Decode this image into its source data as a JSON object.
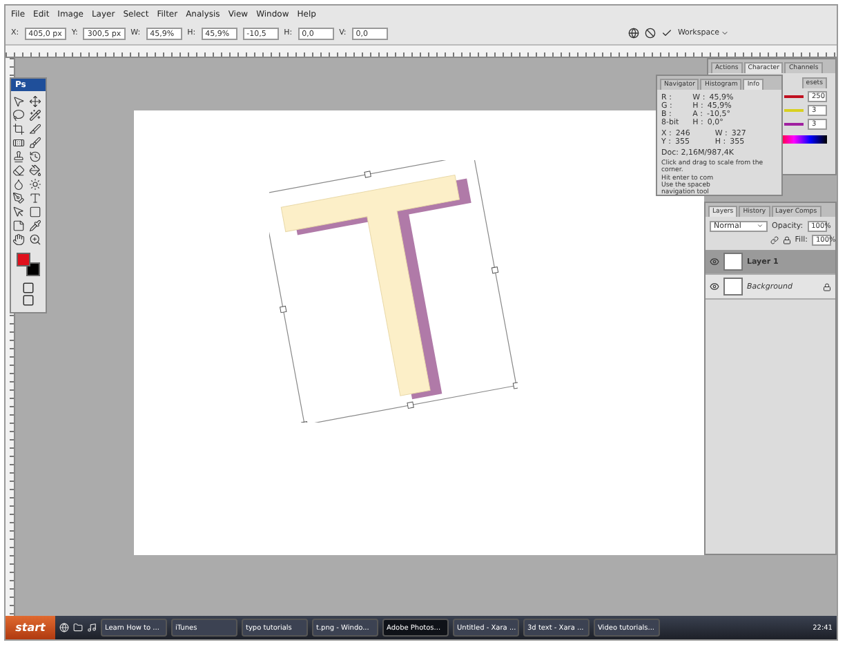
{
  "menu": [
    "File",
    "Edit",
    "Image",
    "Layer",
    "Select",
    "Filter",
    "Analysis",
    "View",
    "Window",
    "Help"
  ],
  "options": {
    "fields": [
      {
        "label": "X:",
        "value": "405,0 px"
      },
      {
        "label": "Y:",
        "value": "300,5 px"
      },
      {
        "label": "W:",
        "value": "45,9%"
      },
      {
        "label": "H:",
        "value": "45,9%"
      },
      {
        "value": "-10,5"
      },
      {
        "label": "H:",
        "value": "0,0"
      },
      {
        "label": "V:",
        "value": "0,0"
      }
    ],
    "workspace": "Workspace"
  },
  "toolbox": {
    "title": "Ps"
  },
  "color_panel": {
    "tabs": [
      {
        "label": "Actions",
        "selected": false
      },
      {
        "label": "Character",
        "selected": true
      },
      {
        "label": "Channels",
        "selected": false
      }
    ],
    "sliders": [
      {
        "color": "#c01020",
        "value": "250"
      },
      {
        "color": "#d8d020",
        "value": "3"
      },
      {
        "color": "#a020a0",
        "value": "3"
      }
    ],
    "cut_tab": "esets"
  },
  "info_panel": {
    "tabs": [
      {
        "label": "Navigator",
        "selected": false
      },
      {
        "label": "Histogram",
        "selected": false
      },
      {
        "label": "Info",
        "selected": true
      }
    ],
    "rows_left": [
      {
        "label": "R :"
      },
      {
        "label": "G :"
      },
      {
        "label": "B :"
      }
    ],
    "bit": "8-bit",
    "rows_right": [
      {
        "label": "W :",
        "value": "45,9%"
      },
      {
        "label": "H :",
        "value": "45,9%"
      },
      {
        "label": "A :",
        "value": "-10,5°"
      },
      {
        "label": "H :",
        "value": "0,0°"
      }
    ],
    "pos": [
      {
        "label": "X :",
        "value": "246"
      },
      {
        "label": "Y :",
        "value": "355"
      }
    ],
    "size": [
      {
        "label": "W :",
        "value": "327"
      },
      {
        "label": "H :",
        "value": "355"
      }
    ],
    "doc": "Doc: 2,16M/987,4K",
    "hint": [
      "Click and drag to scale from the corner.",
      "Hit enter to com",
      "Use the spaceb",
      "navigation tool"
    ]
  },
  "layers_panel": {
    "tabs": [
      {
        "label": "Layers",
        "selected": true
      },
      {
        "label": "History",
        "selected": false
      },
      {
        "label": "Layer Comps",
        "selected": false
      }
    ],
    "blend": "Normal",
    "opacity_label": "Opacity:",
    "opacity": "100%",
    "fill_label": "Fill:",
    "fill": "100%",
    "layers": [
      {
        "name": "Layer 1",
        "selected": true,
        "visible": true,
        "locked": false
      },
      {
        "name": "Background",
        "selected": false,
        "visible": true,
        "locked": true
      }
    ]
  },
  "taskbar": {
    "start": "start",
    "tasks": [
      {
        "label": "Learn How to ...",
        "selected": false
      },
      {
        "label": "iTunes",
        "selected": false
      },
      {
        "label": "typo tutorials",
        "selected": false
      },
      {
        "label": "t.png - Windo...",
        "selected": false
      },
      {
        "label": "Adobe Photos...",
        "selected": true
      },
      {
        "label": "Untitled - Xara ...",
        "selected": false
      },
      {
        "label": "3d text - Xara ...",
        "selected": false
      },
      {
        "label": "Video tutorials...",
        "selected": false
      }
    ],
    "clock": "22:41"
  }
}
